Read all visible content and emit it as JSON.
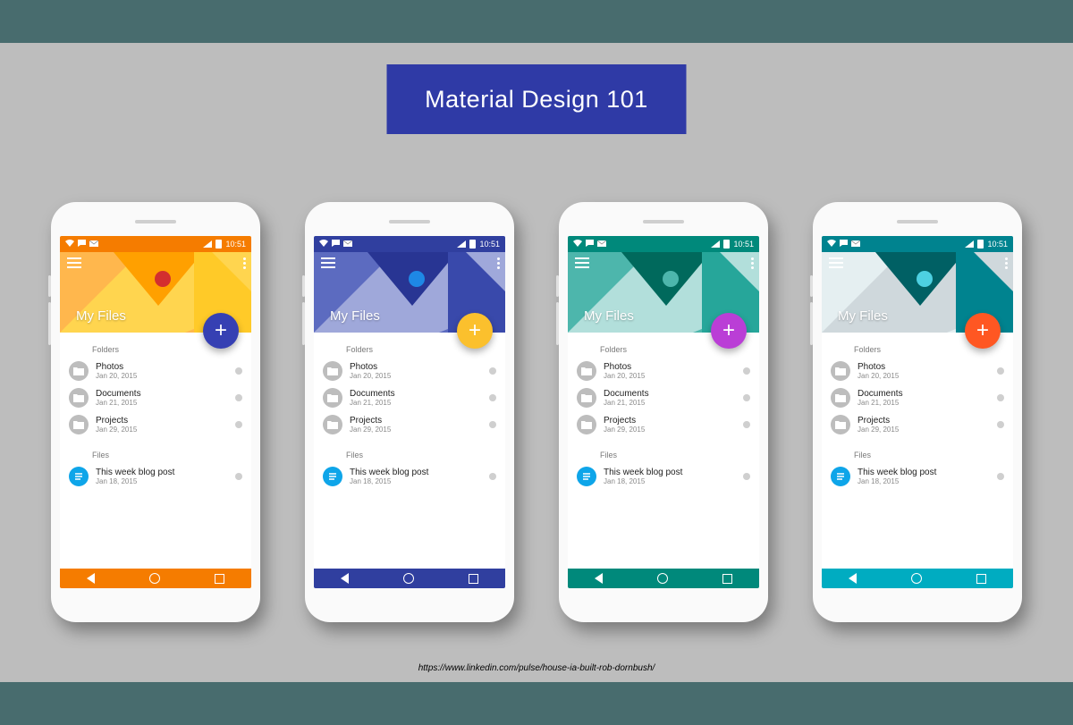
{
  "banner": {
    "title": "Material Design 101"
  },
  "credit_url": "https://www.linkedin.com/pulse/house-ia-built-rob-dornbush/",
  "status": {
    "time": "10:51"
  },
  "app": {
    "title": "My Files",
    "section_folders": "Folders",
    "section_files": "Files",
    "folders": [
      {
        "name": "Photos",
        "date": "Jan 20, 2015"
      },
      {
        "name": "Documents",
        "date": "Jan 21, 2015"
      },
      {
        "name": "Projects",
        "date": "Jan 29, 2015"
      }
    ],
    "files": [
      {
        "name": "This week blog post",
        "date": "Jan 18, 2015"
      }
    ]
  },
  "themes": [
    {
      "status": "#f57c00",
      "appbar": "#ffb74d",
      "navbar": "#f57c00",
      "fab": "#3640b3",
      "shapes": [
        "#ffd54f",
        "#ffa000",
        "#ffca28"
      ],
      "dot": "#d32f2f"
    },
    {
      "status": "#303f9f",
      "appbar": "#5c6bc0",
      "navbar": "#303f9f",
      "fab": "#fbc02d",
      "shapes": [
        "#9fa8da",
        "#283593",
        "#3949ab"
      ],
      "dot": "#1e88e5"
    },
    {
      "status": "#00897b",
      "appbar": "#4db6ac",
      "navbar": "#00897b",
      "fab": "#ba3ed6",
      "shapes": [
        "#b2dfdb",
        "#00695c",
        "#26a69a"
      ],
      "dot": "#4db6ac"
    },
    {
      "status": "#00838f",
      "appbar": "#e5eff1",
      "navbar": "#00acc1",
      "fab": "#ff5722",
      "shapes": [
        "#cfd8dc",
        "#006064",
        "#00838f"
      ],
      "dot": "#4dd0e1"
    }
  ]
}
